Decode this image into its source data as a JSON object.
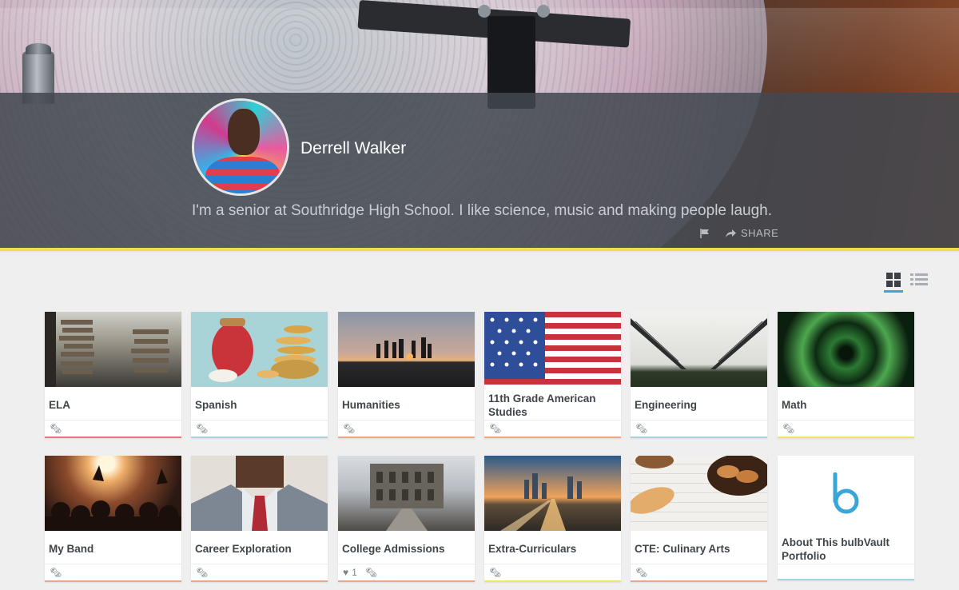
{
  "profile": {
    "name": "Derrell Walker",
    "bio": "I'm a senior at Southridge High School. I like science, music and making people laugh.",
    "share_label": "SHARE"
  },
  "view_toggle": {
    "active": "grid"
  },
  "cards": [
    {
      "title": "ELA",
      "stripe": "#e9787e",
      "likes": ""
    },
    {
      "title": "Spanish",
      "stripe": "#a6d4dc",
      "likes": ""
    },
    {
      "title": "Humanities",
      "stripe": "#f0a683",
      "likes": ""
    },
    {
      "title": "11th Grade American Studies",
      "stripe": "#f0a683",
      "likes": ""
    },
    {
      "title": "Engineering",
      "stripe": "#a6d4dc",
      "likes": ""
    },
    {
      "title": "Math",
      "stripe": "#f2e36a",
      "likes": ""
    },
    {
      "title": "My Band",
      "stripe": "#f0a683",
      "likes": ""
    },
    {
      "title": "Career Exploration",
      "stripe": "#f0a683",
      "likes": ""
    },
    {
      "title": "College Admissions",
      "stripe": "#f0a683",
      "likes": "1"
    },
    {
      "title": "Extra-Curriculars",
      "stripe": "#f2e36a",
      "likes": ""
    },
    {
      "title": "CTE: Culinary Arts",
      "stripe": "#f0a683",
      "likes": ""
    },
    {
      "title": "About This bulbVault Portfolio",
      "stripe": "#a6d4dc",
      "likes": ""
    }
  ],
  "colors": {
    "accent": "#3aa6d8",
    "divider": "#f2de48"
  }
}
